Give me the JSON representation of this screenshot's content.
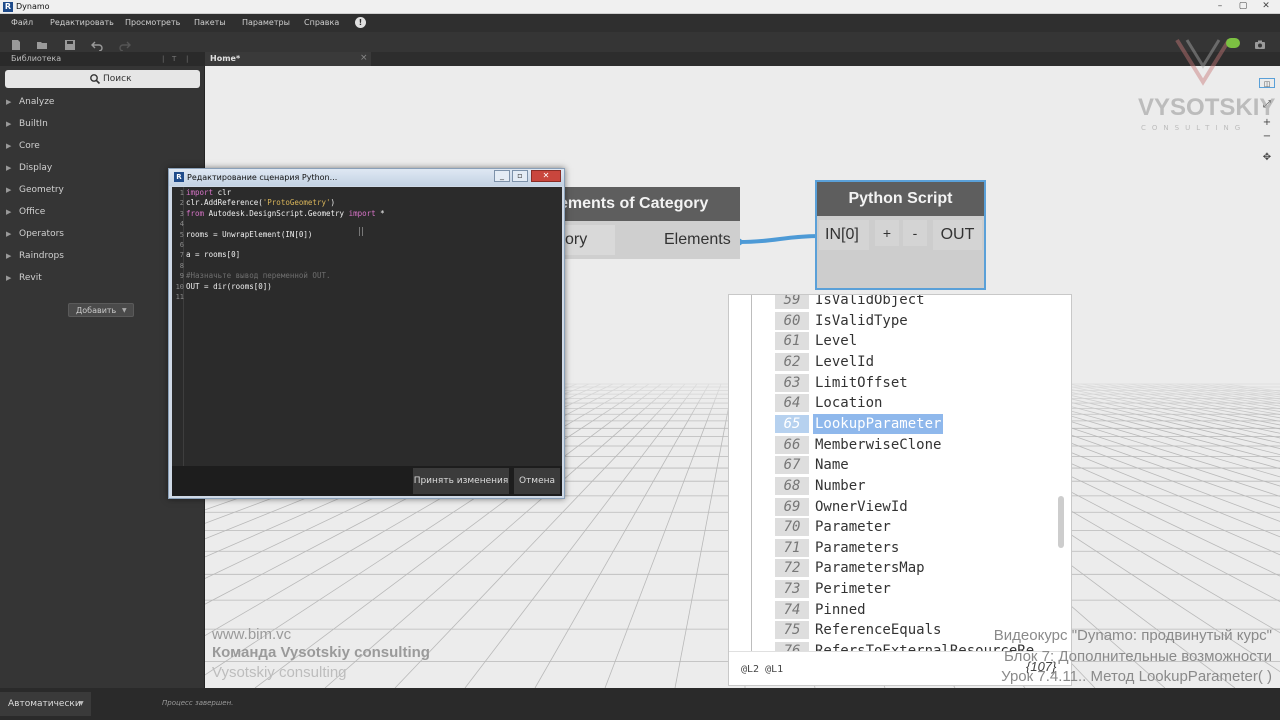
{
  "window": {
    "title": "Dynamo"
  },
  "menu": {
    "items": [
      "Файл",
      "Редактировать",
      "Просмотреть",
      "Пакеты",
      "Параметры",
      "Справка"
    ]
  },
  "library": {
    "header": "Библиотека",
    "search_label": "Поиск",
    "categories": [
      "Analyze",
      "BuiltIn",
      "Core",
      "Display",
      "Geometry",
      "Office",
      "Operators",
      "Raindrops",
      "Revit"
    ],
    "add_label": "Добавить"
  },
  "tab": {
    "label": "Home*"
  },
  "nodes": {
    "category": {
      "title": "ements of Category",
      "input_label": "ory",
      "output_label": "Elements"
    },
    "python": {
      "title": "Python Script",
      "input_label": "IN[0]",
      "add_label": "+",
      "remove_label": "-",
      "output_label": "OUT"
    }
  },
  "preview": {
    "rows": [
      {
        "index": "59",
        "value": "IsValidObject"
      },
      {
        "index": "60",
        "value": "IsValidType"
      },
      {
        "index": "61",
        "value": "Level"
      },
      {
        "index": "62",
        "value": "LevelId"
      },
      {
        "index": "63",
        "value": "LimitOffset"
      },
      {
        "index": "64",
        "value": "Location"
      },
      {
        "index": "65",
        "value": "LookupParameter"
      },
      {
        "index": "66",
        "value": "MemberwiseClone"
      },
      {
        "index": "67",
        "value": "Name"
      },
      {
        "index": "68",
        "value": "Number"
      },
      {
        "index": "69",
        "value": "OwnerViewId"
      },
      {
        "index": "70",
        "value": "Parameter"
      },
      {
        "index": "71",
        "value": "Parameters"
      },
      {
        "index": "72",
        "value": "ParametersMap"
      },
      {
        "index": "73",
        "value": "Perimeter"
      },
      {
        "index": "74",
        "value": "Pinned"
      },
      {
        "index": "75",
        "value": "ReferenceEquals"
      },
      {
        "index": "76",
        "value": "RefersToExternalResourceRe"
      }
    ],
    "selected_index": "65",
    "footer": "@L2 @L1",
    "count": "{107}"
  },
  "python_editor": {
    "title": "Редактирование сценария Python...",
    "lines": [
      {
        "n": "1",
        "parts": [
          {
            "t": "import",
            "c": "kw"
          },
          {
            "t": " clr",
            "c": ""
          }
        ]
      },
      {
        "n": "2",
        "parts": [
          {
            "t": "clr.AddReference(",
            "c": ""
          },
          {
            "t": "'ProtoGeometry'",
            "c": "str"
          },
          {
            "t": ")",
            "c": ""
          }
        ]
      },
      {
        "n": "3",
        "parts": [
          {
            "t": "from",
            "c": "kw"
          },
          {
            "t": " Autodesk.DesignScript.Geometry ",
            "c": ""
          },
          {
            "t": "import",
            "c": "kw"
          },
          {
            "t": " *",
            "c": ""
          }
        ]
      },
      {
        "n": "4",
        "parts": []
      },
      {
        "n": "5",
        "parts": [
          {
            "t": "rooms = UnwrapElement(IN[0])",
            "c": ""
          }
        ]
      },
      {
        "n": "6",
        "parts": []
      },
      {
        "n": "7",
        "parts": [
          {
            "t": "a = rooms[0]",
            "c": ""
          }
        ]
      },
      {
        "n": "8",
        "parts": []
      },
      {
        "n": "9",
        "parts": [
          {
            "t": "#Назначьте вывод переменной OUT.",
            "c": "cm"
          }
        ]
      },
      {
        "n": "10",
        "parts": [
          {
            "t": "OUT = dir(rooms[0])",
            "c": ""
          }
        ]
      },
      {
        "n": "11",
        "parts": []
      }
    ],
    "accept_label": "Принять изменения",
    "cancel_label": "Отмена"
  },
  "watermark": {
    "name": "VYSOTSKIY",
    "sub": "CONSULTING"
  },
  "overlay": {
    "site": "www.bim.vc",
    "team": "Команда Vysotskiy consulting",
    "team2": "Vysotskiy consulting",
    "course": "Видеокурс \"Dynamo: продвинутый курс\"",
    "block": "Блок 7: Дополнительные возможности",
    "lesson": "Урок 7.4.11.. Метод LookupParameter( )"
  },
  "status": {
    "run_mode": "Автоматически",
    "message": "Процесс завершен."
  },
  "icons": [
    "new-file-icon",
    "open-file-icon",
    "save-icon",
    "undo-icon",
    "redo-icon",
    "search-icon",
    "camera-icon",
    "info-icon"
  ]
}
